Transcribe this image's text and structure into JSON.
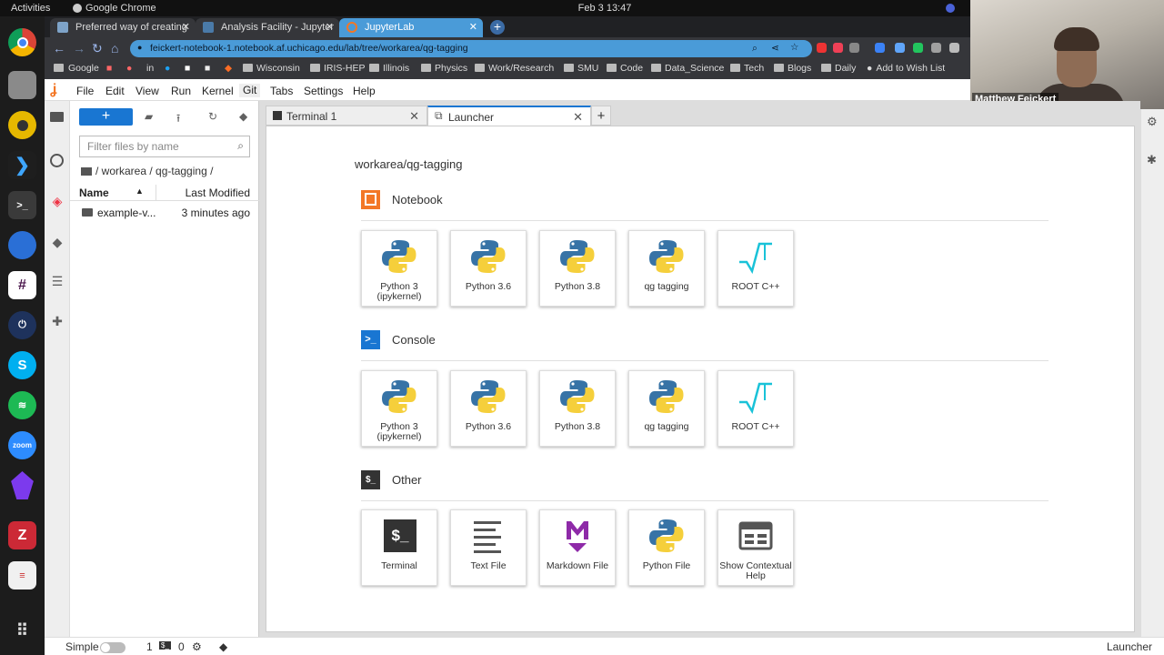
{
  "os": {
    "activities": "Activities",
    "app_name": "Google Chrome",
    "clock": "Feb 3  13:47"
  },
  "browser": {
    "tabs": [
      {
        "label": "Preferred way of creating"
      },
      {
        "label": "Analysis Facility - Jupyter"
      },
      {
        "label": "JupyterLab"
      }
    ],
    "url": "feickert-notebook-1.notebook.af.uchicago.edu/lab/tree/workarea/qg-tagging",
    "bookmarks": [
      "Google",
      "in",
      "Wisconsin",
      "IRIS-HEP",
      "Illinois",
      "Physics",
      "Work/Research",
      "SMU",
      "Code",
      "Data_Science",
      "Tech",
      "Blogs",
      "Daily",
      "Add to Wish List"
    ]
  },
  "webcam": {
    "name": "Matthew Feickert"
  },
  "jupyter": {
    "menu": [
      "File",
      "Edit",
      "View",
      "Run",
      "Kernel",
      "Git",
      "Tabs",
      "Settings",
      "Help"
    ],
    "filebrowser": {
      "new_label": "+",
      "filter_placeholder": "Filter files by name",
      "breadcrumb": "/ workarea / qg-tagging /",
      "col_name": "Name",
      "col_modified": "Last Modified",
      "rows": [
        {
          "name": "example-v...",
          "modified": "3 minutes ago"
        }
      ]
    },
    "doc_tabs": [
      {
        "label": "Terminal 1"
      },
      {
        "label": "Launcher"
      }
    ],
    "launcher": {
      "path": "workarea/qg-tagging",
      "notebook_title": "Notebook",
      "console_title": "Console",
      "other_title": "Other",
      "kernels": [
        "Python 3\n(ipykernel)",
        "Python 3.6",
        "Python 3.8",
        "qg tagging",
        "ROOT C++"
      ],
      "other": [
        "Terminal",
        "Text File",
        "Markdown File",
        "Python File",
        "Show Contextual\nHelp"
      ]
    },
    "status": {
      "mode": "Simple",
      "terminals": "1",
      "kernels": "0",
      "right": "Launcher"
    }
  },
  "colors": {
    "accent": "#1976d2",
    "jupyter_orange": "#f37726",
    "url_bar": "#4a9bd8"
  }
}
